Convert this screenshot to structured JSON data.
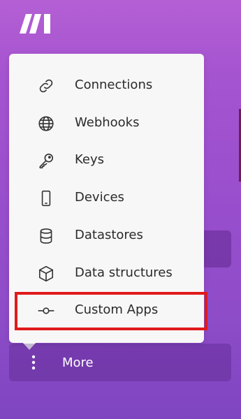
{
  "menu": {
    "items": [
      {
        "label": "Connections",
        "icon": "link-icon"
      },
      {
        "label": "Webhooks",
        "icon": "globe-icon"
      },
      {
        "label": "Keys",
        "icon": "key-icon"
      },
      {
        "label": "Devices",
        "icon": "smartphone-icon"
      },
      {
        "label": "Datastores",
        "icon": "database-icon"
      },
      {
        "label": "Data structures",
        "icon": "cube-icon"
      },
      {
        "label": "Custom Apps",
        "icon": "commit-icon"
      }
    ],
    "highlighted_item": "Custom Apps",
    "highlight_color": "#e0191b"
  },
  "sidebar": {
    "more_label": "More"
  },
  "colors": {
    "background_top": "#b45fd4",
    "background_bottom": "#7f45c1",
    "menu_background": "#f7f7f7"
  }
}
